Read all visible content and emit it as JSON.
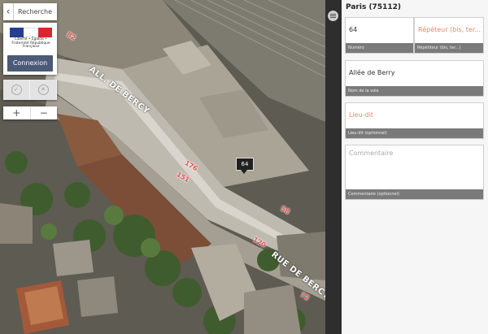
{
  "map": {
    "back_label": "Recherche",
    "gov_flag_colors": [
      "#243f8f",
      "#ffffff",
      "#d72631"
    ],
    "gov_text": "Liberté • Égalité • Fraternité République Française",
    "connexion_label": "Connexion",
    "validate_icon": "check-icon",
    "cancel_icon": "cross-icon",
    "zoom_in": "+",
    "zoom_out": "−",
    "marker_label": "64",
    "streets": [
      "ALL. DE BERCY",
      "RUE DE BERCY"
    ],
    "house_numbers": [
      "82",
      "64",
      "176",
      "151",
      "58",
      "120",
      "72"
    ]
  },
  "sidebar": {
    "menu_icon": "hamburger-menu-icon",
    "commune": "Paris (75112)",
    "numero": {
      "value": "64",
      "label": "Numéro"
    },
    "repetiteur": {
      "placeholder": "Répéteur (bis, ter...)",
      "label": "Répétiteur (bis, ter...)"
    },
    "voie": {
      "value": "Allée de Berry",
      "label": "Nom de la voie"
    },
    "lieu_dit": {
      "placeholder": "Lieu-dit",
      "label": "Lieu-dit (optionnel)"
    },
    "commentaire": {
      "placeholder": "Commentaire",
      "label": "Commentaire (optionnel)"
    }
  }
}
